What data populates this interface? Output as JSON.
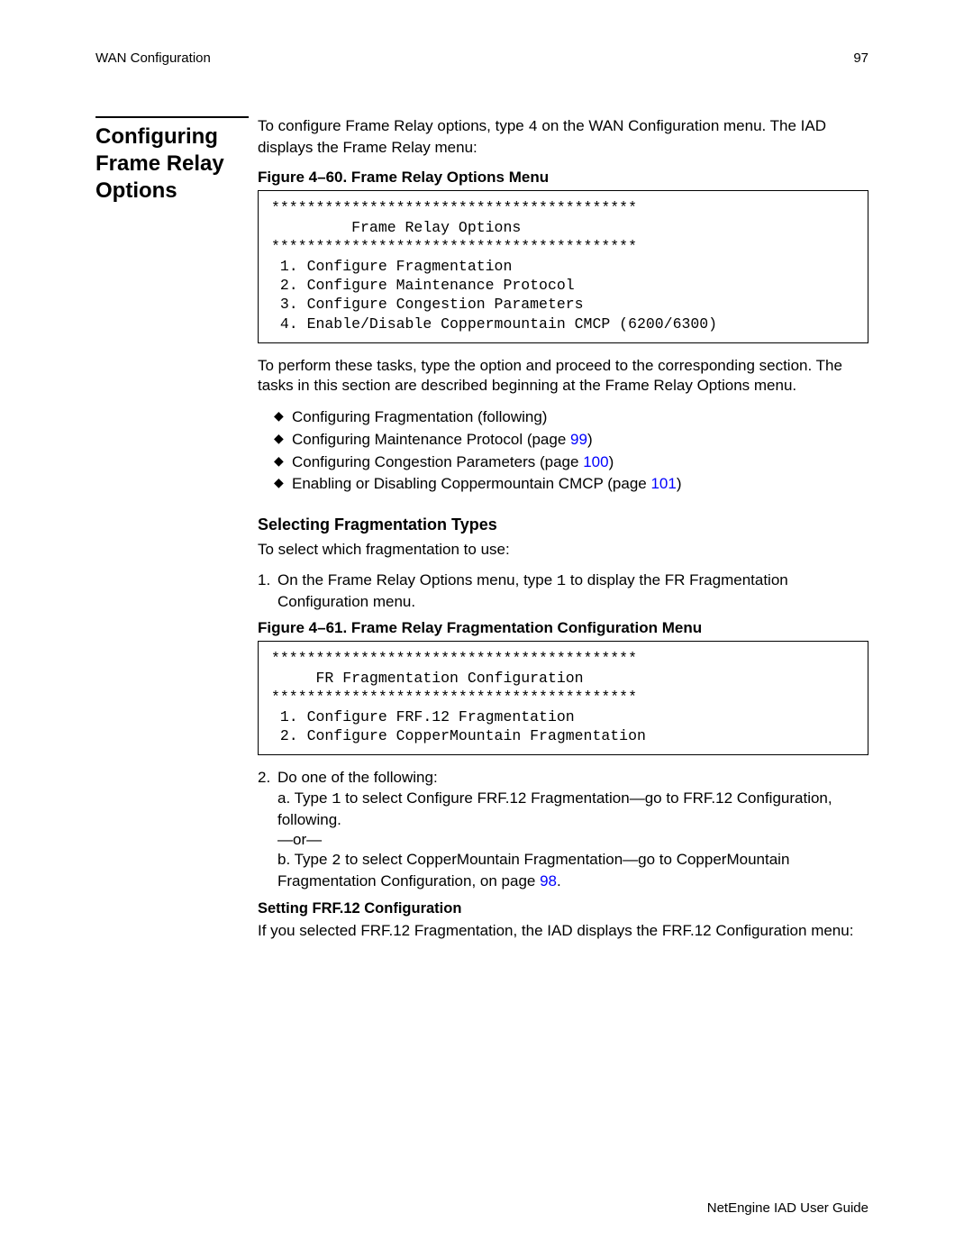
{
  "header": {
    "left": "WAN Configuration",
    "right": "97"
  },
  "sideHeading": "Configuring Frame Relay Options",
  "intro": {
    "pre": "To configure Frame Relay options, type ",
    "key": "4",
    "post": " on the WAN Configuration menu. The IAD displays the Frame Relay menu:"
  },
  "fig60": {
    "caption": "Figure 4–60.  Frame Relay Options Menu",
    "code": "*****************************************\n         Frame Relay Options\n*****************************************\n 1. Configure Fragmentation\n 2. Configure Maintenance Protocol\n 3. Configure Congestion Parameters\n 4. Enable/Disable Coppermountain CMCP (6200/6300)"
  },
  "afterFig60": "To perform these tasks, type the option and proceed to the corresponding section. The tasks in this section are described beginning at the Frame Relay Options menu.",
  "bullets": [
    {
      "text": "Configuring Fragmentation (following)"
    },
    {
      "text": "Configuring Maintenance Protocol (page ",
      "linkText": "99",
      "tail": ")"
    },
    {
      "text": "Configuring Congestion Parameters (page ",
      "linkText": "100",
      "tail": ")"
    },
    {
      "text": "Enabling or Disabling Coppermountain CMCP (page ",
      "linkText": "101",
      "tail": ")"
    }
  ],
  "fragSection": {
    "heading": "Selecting Fragmentation Types",
    "intro": "To select which fragmentation to use:",
    "step1": {
      "num": "1.",
      "pre": "On the Frame Relay Options menu, type ",
      "key": "1",
      "post": " to display the FR Fragmentation Configuration menu."
    }
  },
  "fig61": {
    "caption": "Figure 4–61.  Frame Relay Fragmentation Configuration Menu",
    "code": "*****************************************\n     FR Fragmentation Configuration\n*****************************************\n 1. Configure FRF.12 Fragmentation\n 2. Configure CopperMountain Fragmentation"
  },
  "step2": {
    "num": "2.",
    "lead": "Do one of the following:",
    "a_pre": "a. Type ",
    "a_key": "1",
    "a_post": " to select Configure FRF.12 Fragmentation—go to FRF.12 Configuration, following.",
    "or": "—or—",
    "b_pre": "b. Type ",
    "b_key": "2",
    "b_post_pre": " to select CopperMountain Fragmentation—go to CopperMountain Fragmentation Configuration, on page ",
    "b_link": "98",
    "b_post_tail": "."
  },
  "frf12": {
    "heading": "Setting FRF.12 Configuration",
    "para": "If you selected FRF.12 Fragmentation, the IAD displays the FRF.12 Configuration menu:"
  },
  "footer": "NetEngine IAD User Guide"
}
